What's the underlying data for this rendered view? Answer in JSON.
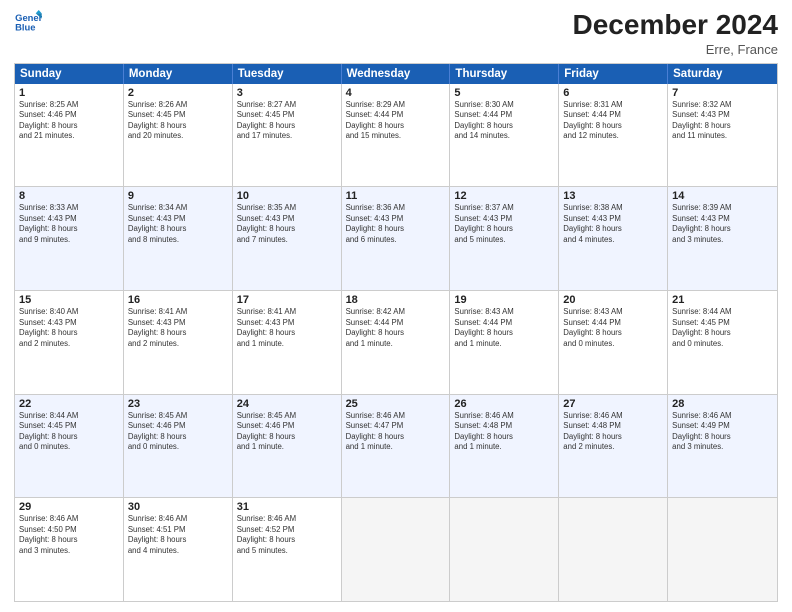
{
  "logo": {
    "line1": "General",
    "line2": "Blue"
  },
  "title": "December 2024",
  "subtitle": "Erre, France",
  "days": [
    "Sunday",
    "Monday",
    "Tuesday",
    "Wednesday",
    "Thursday",
    "Friday",
    "Saturday"
  ],
  "rows": [
    [
      {
        "day": "1",
        "lines": [
          "Sunrise: 8:25 AM",
          "Sunset: 4:46 PM",
          "Daylight: 8 hours",
          "and 21 minutes."
        ]
      },
      {
        "day": "2",
        "lines": [
          "Sunrise: 8:26 AM",
          "Sunset: 4:45 PM",
          "Daylight: 8 hours",
          "and 20 minutes."
        ]
      },
      {
        "day": "3",
        "lines": [
          "Sunrise: 8:27 AM",
          "Sunset: 4:45 PM",
          "Daylight: 8 hours",
          "and 17 minutes."
        ]
      },
      {
        "day": "4",
        "lines": [
          "Sunrise: 8:29 AM",
          "Sunset: 4:44 PM",
          "Daylight: 8 hours",
          "and 15 minutes."
        ]
      },
      {
        "day": "5",
        "lines": [
          "Sunrise: 8:30 AM",
          "Sunset: 4:44 PM",
          "Daylight: 8 hours",
          "and 14 minutes."
        ]
      },
      {
        "day": "6",
        "lines": [
          "Sunrise: 8:31 AM",
          "Sunset: 4:44 PM",
          "Daylight: 8 hours",
          "and 12 minutes."
        ]
      },
      {
        "day": "7",
        "lines": [
          "Sunrise: 8:32 AM",
          "Sunset: 4:43 PM",
          "Daylight: 8 hours",
          "and 11 minutes."
        ]
      }
    ],
    [
      {
        "day": "8",
        "lines": [
          "Sunrise: 8:33 AM",
          "Sunset: 4:43 PM",
          "Daylight: 8 hours",
          "and 9 minutes."
        ]
      },
      {
        "day": "9",
        "lines": [
          "Sunrise: 8:34 AM",
          "Sunset: 4:43 PM",
          "Daylight: 8 hours",
          "and 8 minutes."
        ]
      },
      {
        "day": "10",
        "lines": [
          "Sunrise: 8:35 AM",
          "Sunset: 4:43 PM",
          "Daylight: 8 hours",
          "and 7 minutes."
        ]
      },
      {
        "day": "11",
        "lines": [
          "Sunrise: 8:36 AM",
          "Sunset: 4:43 PM",
          "Daylight: 8 hours",
          "and 6 minutes."
        ]
      },
      {
        "day": "12",
        "lines": [
          "Sunrise: 8:37 AM",
          "Sunset: 4:43 PM",
          "Daylight: 8 hours",
          "and 5 minutes."
        ]
      },
      {
        "day": "13",
        "lines": [
          "Sunrise: 8:38 AM",
          "Sunset: 4:43 PM",
          "Daylight: 8 hours",
          "and 4 minutes."
        ]
      },
      {
        "day": "14",
        "lines": [
          "Sunrise: 8:39 AM",
          "Sunset: 4:43 PM",
          "Daylight: 8 hours",
          "and 3 minutes."
        ]
      }
    ],
    [
      {
        "day": "15",
        "lines": [
          "Sunrise: 8:40 AM",
          "Sunset: 4:43 PM",
          "Daylight: 8 hours",
          "and 2 minutes."
        ]
      },
      {
        "day": "16",
        "lines": [
          "Sunrise: 8:41 AM",
          "Sunset: 4:43 PM",
          "Daylight: 8 hours",
          "and 2 minutes."
        ]
      },
      {
        "day": "17",
        "lines": [
          "Sunrise: 8:41 AM",
          "Sunset: 4:43 PM",
          "Daylight: 8 hours",
          "and 1 minute."
        ]
      },
      {
        "day": "18",
        "lines": [
          "Sunrise: 8:42 AM",
          "Sunset: 4:44 PM",
          "Daylight: 8 hours",
          "and 1 minute."
        ]
      },
      {
        "day": "19",
        "lines": [
          "Sunrise: 8:43 AM",
          "Sunset: 4:44 PM",
          "Daylight: 8 hours",
          "and 1 minute."
        ]
      },
      {
        "day": "20",
        "lines": [
          "Sunrise: 8:43 AM",
          "Sunset: 4:44 PM",
          "Daylight: 8 hours",
          "and 0 minutes."
        ]
      },
      {
        "day": "21",
        "lines": [
          "Sunrise: 8:44 AM",
          "Sunset: 4:45 PM",
          "Daylight: 8 hours",
          "and 0 minutes."
        ]
      }
    ],
    [
      {
        "day": "22",
        "lines": [
          "Sunrise: 8:44 AM",
          "Sunset: 4:45 PM",
          "Daylight: 8 hours",
          "and 0 minutes."
        ]
      },
      {
        "day": "23",
        "lines": [
          "Sunrise: 8:45 AM",
          "Sunset: 4:46 PM",
          "Daylight: 8 hours",
          "and 0 minutes."
        ]
      },
      {
        "day": "24",
        "lines": [
          "Sunrise: 8:45 AM",
          "Sunset: 4:46 PM",
          "Daylight: 8 hours",
          "and 1 minute."
        ]
      },
      {
        "day": "25",
        "lines": [
          "Sunrise: 8:46 AM",
          "Sunset: 4:47 PM",
          "Daylight: 8 hours",
          "and 1 minute."
        ]
      },
      {
        "day": "26",
        "lines": [
          "Sunrise: 8:46 AM",
          "Sunset: 4:48 PM",
          "Daylight: 8 hours",
          "and 1 minute."
        ]
      },
      {
        "day": "27",
        "lines": [
          "Sunrise: 8:46 AM",
          "Sunset: 4:48 PM",
          "Daylight: 8 hours",
          "and 2 minutes."
        ]
      },
      {
        "day": "28",
        "lines": [
          "Sunrise: 8:46 AM",
          "Sunset: 4:49 PM",
          "Daylight: 8 hours",
          "and 3 minutes."
        ]
      }
    ],
    [
      {
        "day": "29",
        "lines": [
          "Sunrise: 8:46 AM",
          "Sunset: 4:50 PM",
          "Daylight: 8 hours",
          "and 3 minutes."
        ]
      },
      {
        "day": "30",
        "lines": [
          "Sunrise: 8:46 AM",
          "Sunset: 4:51 PM",
          "Daylight: 8 hours",
          "and 4 minutes."
        ]
      },
      {
        "day": "31",
        "lines": [
          "Sunrise: 8:46 AM",
          "Sunset: 4:52 PM",
          "Daylight: 8 hours",
          "and 5 minutes."
        ]
      },
      {
        "day": "",
        "lines": []
      },
      {
        "day": "",
        "lines": []
      },
      {
        "day": "",
        "lines": []
      },
      {
        "day": "",
        "lines": []
      }
    ]
  ]
}
